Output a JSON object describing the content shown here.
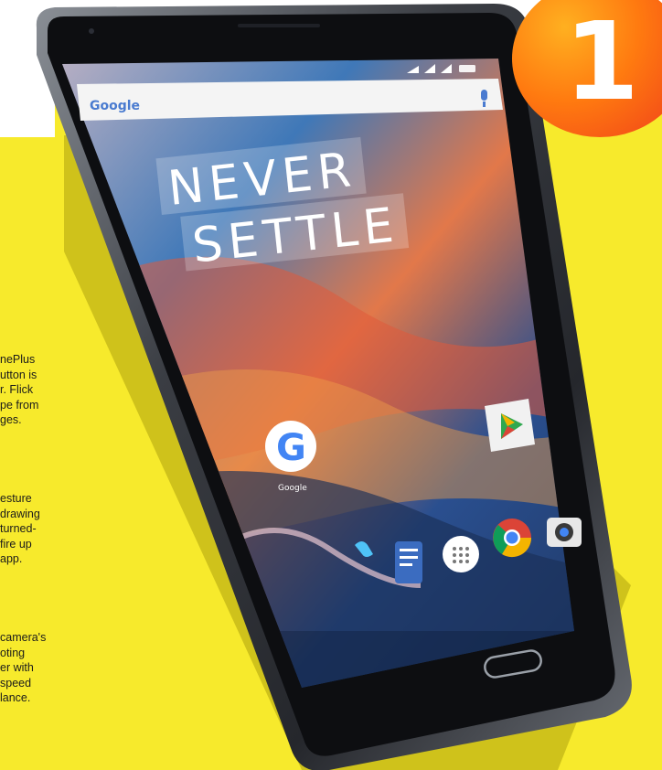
{
  "badge": {
    "number": "1"
  },
  "text_fragments": [
    {
      "lines": [
        "nePlus",
        "utton is",
        "r. Flick",
        "pe from",
        "ges."
      ]
    },
    {
      "lines": [
        "esture",
        "drawing",
        "turned-",
        "fire up",
        "app."
      ]
    },
    {
      "lines": [
        "camera's",
        "oting",
        "er with",
        "speed",
        "lance."
      ]
    }
  ],
  "phone_screen": {
    "search_logo": "Google",
    "slogan_line1": "NEVER",
    "slogan_line2": "SETTLE",
    "app_google_label": "Google"
  },
  "colors": {
    "yellow": "#f7ea2c",
    "shadow": "#cfc21b",
    "badge_orange": "#ff7a10",
    "phone_frame": "#2a2d33"
  }
}
